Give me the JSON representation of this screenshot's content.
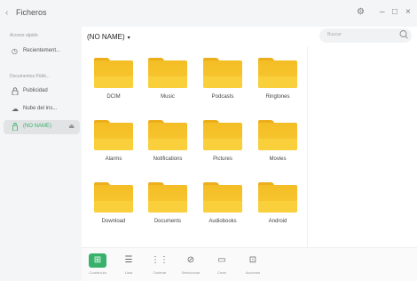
{
  "titlebar": {
    "back_glyph": "‹",
    "title": "Ficheros",
    "settings_glyph": "⚙",
    "minimize_glyph": "–",
    "maximize_glyph": "□",
    "close_glyph": "×"
  },
  "sidebar": {
    "quick_access_label": "Acceso rápido",
    "quick_items": [
      {
        "label": "Recientement...",
        "icon": "clock-icon",
        "glyph": "◷"
      }
    ],
    "documents_label": "Documentos Públi...",
    "doc_items": [
      {
        "label": "Publicidad",
        "icon": "lock-icon",
        "glyph": "🔒"
      },
      {
        "label": "Nube del ins...",
        "icon": "cloud-icon",
        "glyph": "☁"
      },
      {
        "label": "(NO NAME)",
        "icon": "usb-icon",
        "glyph": "⏏",
        "active": true,
        "pin_glyph": "⏏"
      }
    ]
  },
  "main": {
    "breadcrumb": "(NO NAME)",
    "breadcrumb_caret": "▾",
    "search": {
      "placeholder": "Buscar",
      "icon_glyph": "⚲"
    },
    "folders": [
      "DCIM",
      "Music",
      "Podcasts",
      "Ringtones",
      "Alarms",
      "Notifications",
      "Pictures",
      "Movies",
      "Download",
      "Documents",
      "Audiobooks",
      "Android"
    ]
  },
  "toolbar": {
    "buttons": [
      {
        "label": "Cuadrícula",
        "icon": "grid-view-icon",
        "glyph": "⊞",
        "active": true
      },
      {
        "label": "Lista",
        "icon": "list-view-icon",
        "glyph": "☰"
      },
      {
        "label": "Ordenar",
        "icon": "sort-icon",
        "glyph": "⋮⋮"
      },
      {
        "label": "Seleccionar",
        "icon": "check-circle-icon",
        "glyph": "⊘"
      },
      {
        "label": "Crear",
        "icon": "new-folder-icon",
        "glyph": "▭"
      },
      {
        "label": "Acciones",
        "icon": "actions-icon",
        "glyph": "⊡"
      }
    ]
  },
  "colors": {
    "accent": "#38b26b",
    "folder": "#f4bd25",
    "sidebar_bg": "#f4f5f6",
    "main_bg": "#ffffff"
  }
}
